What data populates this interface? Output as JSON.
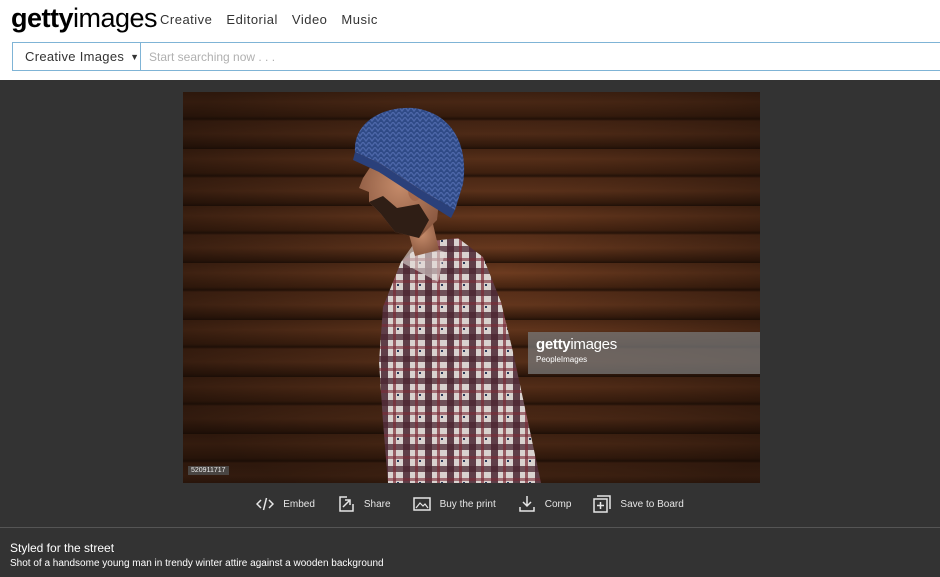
{
  "header": {
    "logo_bold": "getty",
    "logo_light": "images",
    "nav": [
      "Creative",
      "Editorial",
      "Video",
      "Music"
    ]
  },
  "search": {
    "category": "Creative Images",
    "placeholder": "Start searching now . . ."
  },
  "image": {
    "watermark_bold": "getty",
    "watermark_light": "images",
    "watermark_credit": "PeopleImages",
    "image_id": "520911717"
  },
  "actions": {
    "embed": "Embed",
    "share": "Share",
    "buy_print": "Buy the print",
    "comp": "Comp",
    "save_to_board": "Save to Board"
  },
  "caption": {
    "title": "Styled for the street",
    "description": "Shot of a handsome young man in trendy winter attire against a wooden background"
  },
  "icons": [
    "code-icon",
    "share-icon",
    "picture-icon",
    "download-icon",
    "add-to-board-icon",
    "chevron-down-icon"
  ],
  "colors": {
    "header_bg": "#ffffff",
    "search_border": "#7fb4d6",
    "stage_bg": "#333333",
    "action_text": "#e6e6e6"
  }
}
